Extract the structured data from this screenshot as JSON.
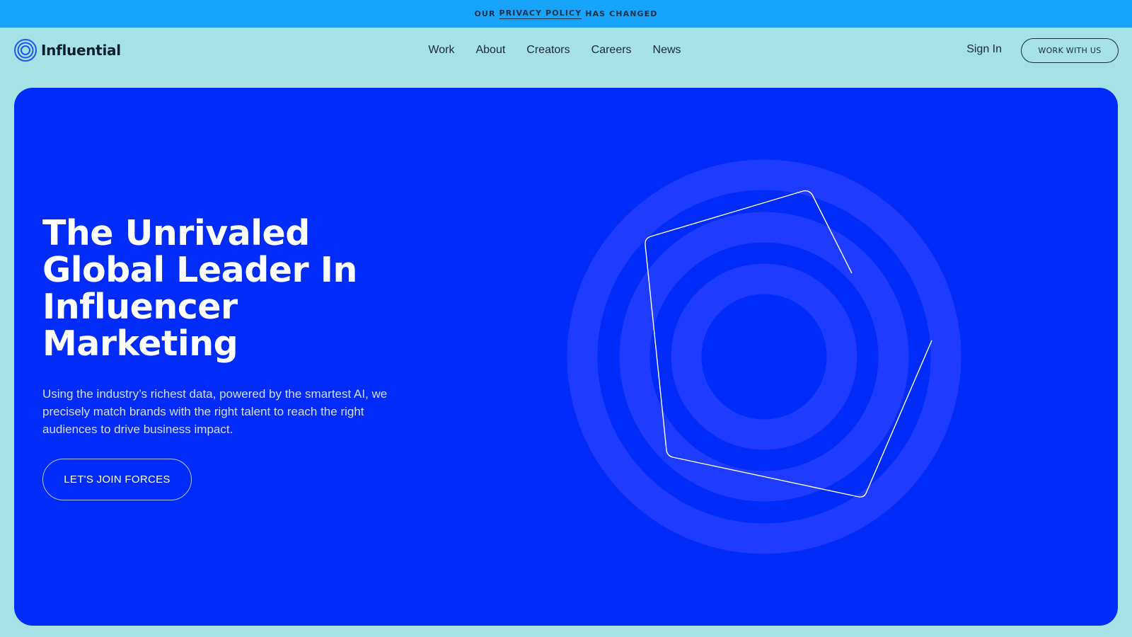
{
  "announcement": {
    "prefix": "OUR",
    "link": "PRIVACY POLICY",
    "suffix": "HAS CHANGED"
  },
  "header": {
    "logo_text": "Influential",
    "nav": [
      {
        "label": "Work"
      },
      {
        "label": "About"
      },
      {
        "label": "Creators"
      },
      {
        "label": "Careers"
      },
      {
        "label": "News"
      }
    ],
    "sign_in": "Sign In",
    "cta": "WORK WITH US"
  },
  "hero": {
    "title_lines": [
      "The Unrivaled",
      "Global Leader In",
      "Influencer",
      "Marketing"
    ],
    "subtitle": "Using the industry’s richest data, powered by the smartest AI, we precisely match brands with the right talent to reach the right audiences to drive business impact.",
    "cta": "LET'S JOIN FORCES"
  },
  "colors": {
    "page_bg": "#a6e1e6",
    "announcement_bg": "#18a4fb",
    "hero_bg": "#012bf8",
    "ring_color": "#1e3bff",
    "text_dark": "#1a2a38"
  },
  "icons": {
    "logo": "concentric-circles-logo-icon"
  }
}
